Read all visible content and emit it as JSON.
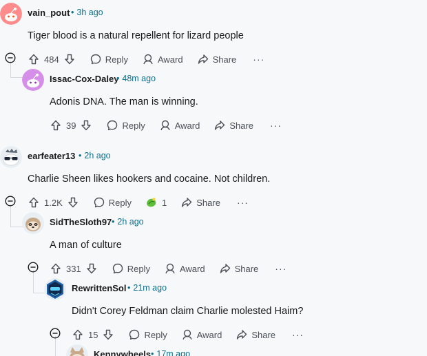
{
  "colors": {
    "meta": "#0e6e8c",
    "text": "#1a1a1b",
    "action": "#4a4f55",
    "thread_line": "#d4d7db"
  },
  "labels": {
    "reply": "Reply",
    "award": "Award",
    "share": "Share",
    "more": "···"
  },
  "comments": [
    {
      "author": "vain_pout",
      "time": "3h ago",
      "body": "Tiger blood is a natural repellent for lizard people",
      "votes": "484",
      "avatar": "default-snoo-avatar-red"
    },
    {
      "author": "Issac-Cox-Daley",
      "time": "48m ago",
      "body": "Adonis DNA. The man is winning.",
      "votes": "39",
      "avatar": "default-snoo-avatar-purple"
    },
    {
      "author": "earfeater13",
      "time": "2h ago",
      "body": "Charlie Sheen likes hookers and cocaine. Not children.",
      "votes": "1.2K",
      "avatar": "sunglasses-snoo-avatar",
      "award_count": "1",
      "award_icon": "green-award-icon"
    },
    {
      "author": "SidTheSloth97",
      "time": "2h ago",
      "body": "A man of culture",
      "votes": "331",
      "avatar": "sloth-snoo-avatar"
    },
    {
      "author": "RewrittenSol",
      "time": "21m ago",
      "body": "Didn't Corey Feldman claim Charlie molested Haim?",
      "votes": "15",
      "avatar": "hex-helmet-avatar"
    },
    {
      "author": "Kennywheels",
      "time": "17m ago",
      "avatar": "cat-snoo-avatar"
    }
  ]
}
